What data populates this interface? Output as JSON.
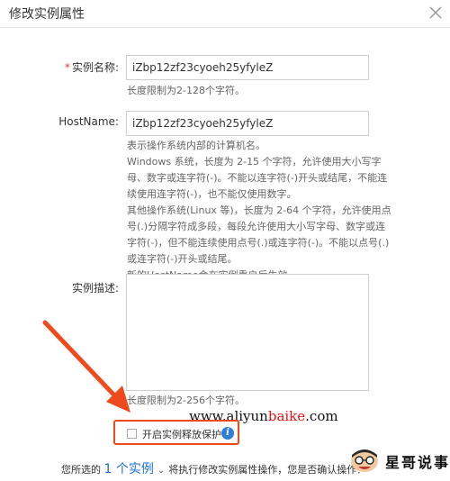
{
  "dialog": {
    "title": "修改实例属性"
  },
  "form": {
    "instance_name": {
      "required_mark": "*",
      "label": "实例名称:",
      "value": "iZbp12zf23cyoeh25yfyleZ",
      "help": "长度限制为2-128个字符。"
    },
    "hostname": {
      "label": "HostName:",
      "value": "iZbp12zf23cyoeh25yfyleZ",
      "help_lines": [
        "表示操作系统内部的计算机名。",
        "Windows 系统，长度为 2-15 个字符，允许使用大小写字",
        "母、数字或连字符(-)。不能以连字符(-)开头或结尾，不能连",
        "续使用连字符(-)，也不能仅使用数字。",
        "其他操作系统(Linux 等)，长度为 2-64 个字符，允许使用点",
        "号(.)分隔字符成多段，每段允许使用大小写字母、数字或连",
        "字符(-)，但不能连续使用点号(.)或连字符(-)。不能以点号(.)",
        "或连字符(-)开头或结尾。",
        "新的HostName会在实例重启后生效。"
      ]
    },
    "description": {
      "label": "实例描述:",
      "value": "",
      "help": "长度限制为2-256个字符。"
    },
    "release_protection": {
      "label": "开启实例释放保护",
      "checked": false,
      "info_icon": "i"
    }
  },
  "watermark": {
    "url_prefix": "www.aliyun",
    "url_highlight": "baike",
    "url_suffix": ".com",
    "brand": "星哥说事"
  },
  "confirm": {
    "prefix": "您所选的",
    "count_link": "1 个实例",
    "suffix": "将执行修改实例属性操作，您是否确认操作？"
  },
  "colors": {
    "arrow": "#ee4a1b",
    "link": "#1a6fd6",
    "required": "#e4393c",
    "info": "#2b7fd6"
  }
}
